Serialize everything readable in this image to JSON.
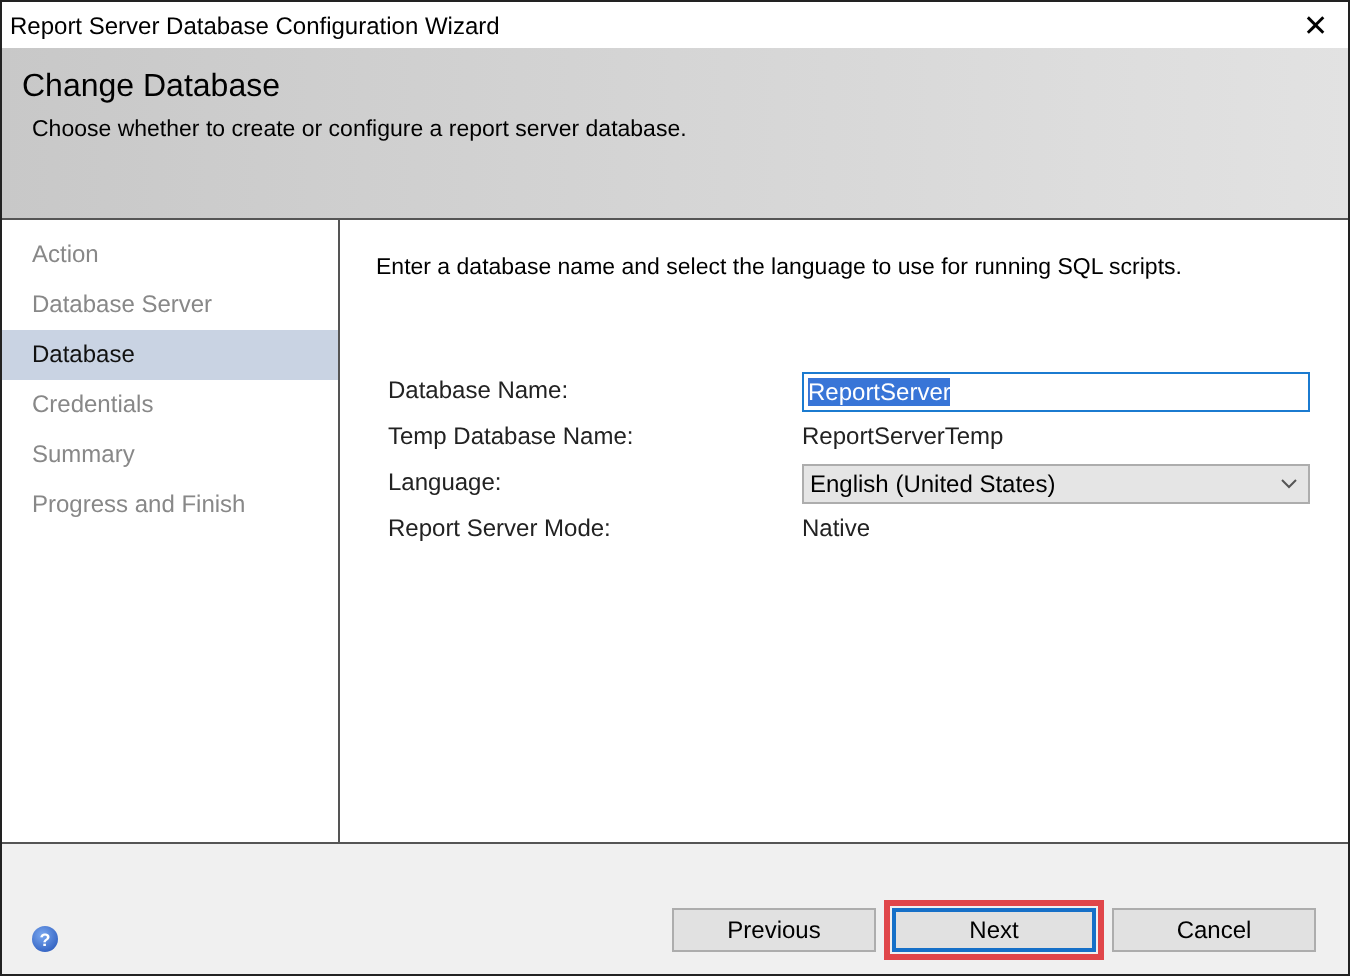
{
  "window": {
    "title": "Report Server Database Configuration Wizard",
    "close": "✕"
  },
  "header": {
    "title": "Change Database",
    "subtitle": "Choose whether to create or configure a report server database."
  },
  "sidebar": {
    "items": [
      {
        "label": "Action",
        "selected": false
      },
      {
        "label": "Database Server",
        "selected": false
      },
      {
        "label": "Database",
        "selected": true
      },
      {
        "label": "Credentials",
        "selected": false
      },
      {
        "label": "Summary",
        "selected": false
      },
      {
        "label": "Progress and Finish",
        "selected": false
      }
    ]
  },
  "content": {
    "instruction": "Enter a database name and select the language to use for running SQL scripts.",
    "fields": [
      {
        "kind": "input",
        "label": "Database Name:",
        "value": "ReportServer",
        "text_selected": true
      },
      {
        "kind": "text",
        "label": "Temp Database Name:",
        "value": "ReportServerTemp"
      },
      {
        "kind": "dropdown",
        "label": "Language:",
        "value": "English (United States)"
      },
      {
        "kind": "text",
        "label": "Report Server Mode:",
        "value": "Native"
      }
    ]
  },
  "footer": {
    "help": "?",
    "buttons": [
      {
        "label": "Previous",
        "default": false,
        "highlighted": false
      },
      {
        "label": "Next",
        "default": true,
        "highlighted": true
      },
      {
        "label": "Cancel",
        "default": false,
        "highlighted": false
      }
    ]
  }
}
